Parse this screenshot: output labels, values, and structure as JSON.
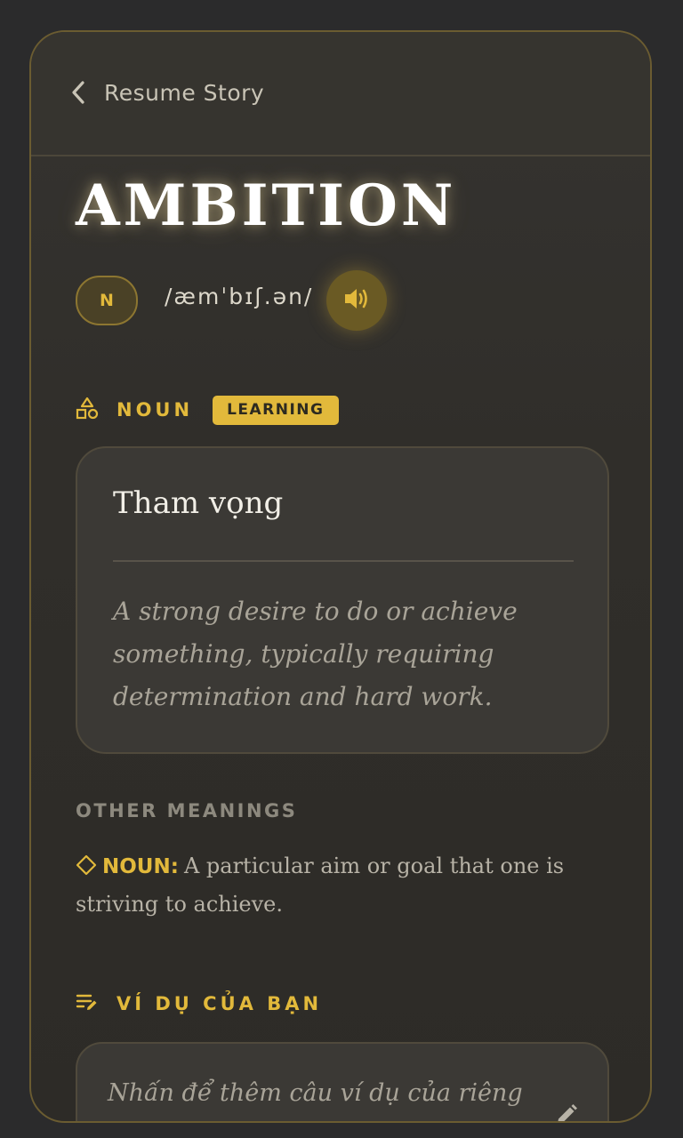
{
  "header": {
    "back_label": "Resume Story"
  },
  "word": {
    "title": "AMBITION",
    "pos_abbrev": "N",
    "ipa": "/æmˈbɪʃ.ən/"
  },
  "primary_section": {
    "pos_label": "NOUN",
    "status_badge": "LEARNING"
  },
  "definition_card": {
    "translation": "Tham vọng",
    "definition": "A strong desire to do or achieve something, typically requiring determination and hard work."
  },
  "other_meanings": {
    "title": "OTHER MEANINGS",
    "items": [
      {
        "pos": "NOUN:",
        "text": "A particular aim or goal that one is striving to achieve."
      }
    ]
  },
  "examples": {
    "title": "VÍ DỤ CỦA BẠN",
    "placeholder": "Nhấn để thêm câu ví dụ của riêng"
  },
  "icons": {
    "back": "chevron-left-icon",
    "audio": "speaker-icon",
    "category": "shapes-icon",
    "other_meaning_bullet": "diamond-icon",
    "examples": "edit-note-icon",
    "edit": "pencil-icon"
  },
  "colors": {
    "accent": "#e2b93b",
    "background": "#2b2b2c",
    "card_border": "#6b5c31"
  }
}
